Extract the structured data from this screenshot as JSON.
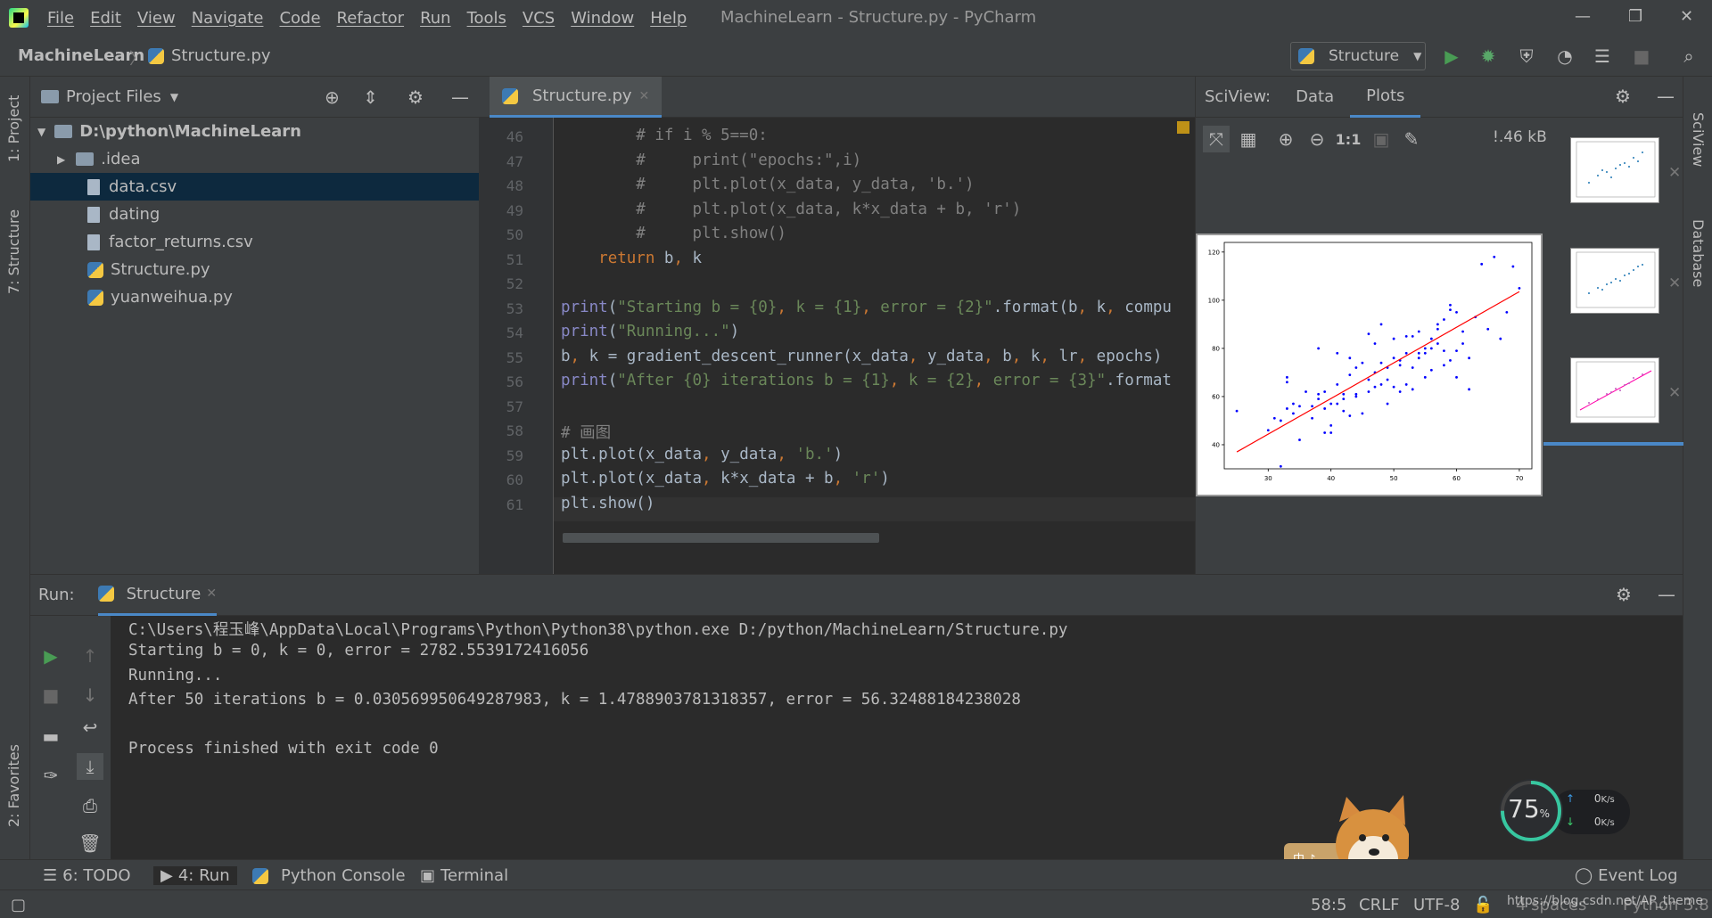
{
  "titlebar": {
    "menu": [
      "File",
      "Edit",
      "View",
      "Navigate",
      "Code",
      "Refactor",
      "Run",
      "Tools",
      "VCS",
      "Window",
      "Help"
    ],
    "window_title": "MachineLearn - Structure.py - PyCharm"
  },
  "navbar": {
    "project": "MachineLearn",
    "file": "Structure.py",
    "run_config": "Structure"
  },
  "left_strip": {
    "project_tab": "1: Project",
    "structure_tab": "7: Structure",
    "favorites_tab": "2: Favorites"
  },
  "right_strip": {
    "sciview_tab": "SciView",
    "database_tab": "Database"
  },
  "project_panel": {
    "header": "Project Files",
    "root": "D:\\python\\MachineLearn",
    "items": [
      ".idea",
      "data.csv",
      "dating",
      "factor_returns.csv",
      "Structure.py",
      "yuanweihua.py"
    ]
  },
  "editor": {
    "tab": "Structure.py",
    "lines": [
      {
        "n": "46",
        "html_code": "        # if i % 5==0:"
      },
      {
        "n": "47",
        "html_code": "        #     print(\"epochs:\",i)"
      },
      {
        "n": "48",
        "html_code": "        #     plt.plot(x_data, y_data, 'b.')"
      },
      {
        "n": "49",
        "html_code": "        #     plt.plot(x_data, k*x_data + b, 'r')"
      },
      {
        "n": "50",
        "html_code": "        #     plt.show()"
      },
      {
        "n": "51",
        "html_code": "    return b, k"
      },
      {
        "n": "52",
        "html_code": ""
      },
      {
        "n": "53",
        "html_code": "print(\"Starting b = {0}, k = {1}, error = {2}\".format(b, k, compu"
      },
      {
        "n": "54",
        "html_code": "print(\"Running...\")"
      },
      {
        "n": "55",
        "html_code": "b, k = gradient_descent_runner(x_data, y_data, b, k, lr, epochs)"
      },
      {
        "n": "56",
        "html_code": "print(\"After {0} iterations b = {1}, k = {2}, error = {3}\".format"
      },
      {
        "n": "57",
        "html_code": ""
      },
      {
        "n": "58",
        "html_code": "# 画图"
      },
      {
        "n": "59",
        "html_code": "plt.plot(x_data, y_data, 'b.')"
      },
      {
        "n": "60",
        "html_code": "plt.plot(x_data, k*x_data + b, 'r')"
      },
      {
        "n": "61",
        "html_code": "plt.show()"
      }
    ]
  },
  "sciview": {
    "label": "SciView:",
    "tabs": [
      "Data",
      "Plots"
    ],
    "size": "!.46 kB",
    "zoom_reset": "1:1"
  },
  "chart_data": {
    "type": "scatter",
    "xticks": [
      "30",
      "40",
      "50",
      "60",
      "70"
    ],
    "yticks": [
      "40",
      "60",
      "80",
      "100",
      "120"
    ],
    "xlim": [
      23,
      72
    ],
    "ylim": [
      30,
      124
    ],
    "points": [
      [
        25,
        54
      ],
      [
        30,
        46
      ],
      [
        31,
        51
      ],
      [
        32,
        50
      ],
      [
        32,
        31
      ],
      [
        33,
        66
      ],
      [
        33,
        55
      ],
      [
        33,
        68
      ],
      [
        34,
        53
      ],
      [
        34,
        57
      ],
      [
        35,
        42
      ],
      [
        35,
        56
      ],
      [
        36,
        62
      ],
      [
        37,
        51
      ],
      [
        37,
        56
      ],
      [
        38,
        61
      ],
      [
        38,
        59
      ],
      [
        38,
        80
      ],
      [
        39,
        55
      ],
      [
        39,
        45
      ],
      [
        39,
        62
      ],
      [
        40,
        48
      ],
      [
        40,
        45
      ],
      [
        40,
        57
      ],
      [
        41,
        65
      ],
      [
        41,
        57
      ],
      [
        41,
        78
      ],
      [
        42,
        61
      ],
      [
        42,
        59
      ],
      [
        42,
        54
      ],
      [
        43,
        69
      ],
      [
        43,
        76
      ],
      [
        43,
        52
      ],
      [
        44,
        61
      ],
      [
        44,
        72
      ],
      [
        44,
        60
      ],
      [
        45,
        74
      ],
      [
        45,
        53
      ],
      [
        46,
        62
      ],
      [
        46,
        67
      ],
      [
        46,
        86
      ],
      [
        47,
        70
      ],
      [
        47,
        64
      ],
      [
        47,
        82
      ],
      [
        48,
        65
      ],
      [
        48,
        74
      ],
      [
        48,
        90
      ],
      [
        49,
        67
      ],
      [
        49,
        72
      ],
      [
        49,
        57
      ],
      [
        50,
        64
      ],
      [
        50,
        76
      ],
      [
        50,
        84
      ],
      [
        51,
        75
      ],
      [
        51,
        62
      ],
      [
        51,
        73
      ],
      [
        52,
        78
      ],
      [
        52,
        85
      ],
      [
        52,
        65
      ],
      [
        53,
        85
      ],
      [
        53,
        63
      ],
      [
        53,
        72
      ],
      [
        54,
        87
      ],
      [
        54,
        76
      ],
      [
        54,
        78
      ],
      [
        55,
        78
      ],
      [
        55,
        80
      ],
      [
        55,
        68
      ],
      [
        56,
        84
      ],
      [
        56,
        71
      ],
      [
        56,
        80
      ],
      [
        57,
        82
      ],
      [
        57,
        88
      ],
      [
        57,
        90
      ],
      [
        58,
        73
      ],
      [
        58,
        79
      ],
      [
        58,
        92
      ],
      [
        59,
        98
      ],
      [
        59,
        75
      ],
      [
        59,
        96
      ],
      [
        60,
        95
      ],
      [
        60,
        79
      ],
      [
        60,
        68
      ],
      [
        61,
        82
      ],
      [
        61,
        87
      ],
      [
        62,
        76
      ],
      [
        62,
        63
      ],
      [
        63,
        93
      ],
      [
        64,
        115
      ],
      [
        65,
        88
      ],
      [
        66,
        118
      ],
      [
        67,
        84
      ],
      [
        68,
        95
      ],
      [
        69,
        114
      ],
      [
        70,
        105
      ]
    ],
    "line": {
      "k": 1.4788903781318357,
      "b": 0.030569950649287983,
      "x_from": 25,
      "x_to": 70
    },
    "marker_color": "#0000ff",
    "line_color": "#ff0000"
  },
  "run_panel": {
    "label": "Run:",
    "tab": "Structure",
    "output": [
      "C:\\Users\\程玉峰\\AppData\\Local\\Programs\\Python\\Python38\\python.exe D:/python/MachineLearn/Structure.py",
      "Starting b = 0, k = 0, error = 2782.5539172416056",
      "Running...",
      "After 50 iterations b = 0.030569950649287983, k = 1.4788903781318357, error = 56.32488184238028",
      "",
      "Process finished with exit code 0"
    ]
  },
  "bottom_tabs": [
    "6: TODO",
    "4: Run",
    "Python Console",
    "Terminal"
  ],
  "event_log": "Event Log",
  "status": {
    "position": "58:5",
    "line_sep": "CRLF",
    "encoding": "UTF-8",
    "indent": "4 spaces",
    "interpreter": "Python 3.8",
    "watermark": "https://blog.csdn.net/AP_theme"
  },
  "gauge": {
    "percent": "75",
    "unit": "%",
    "up": "0",
    "down": "0",
    "rate_unit": "K/s",
    "progress": 0.75
  },
  "colors": {
    "accent": "#4a88c7",
    "run_green": "#499c54",
    "debug_green": "#59a869"
  }
}
